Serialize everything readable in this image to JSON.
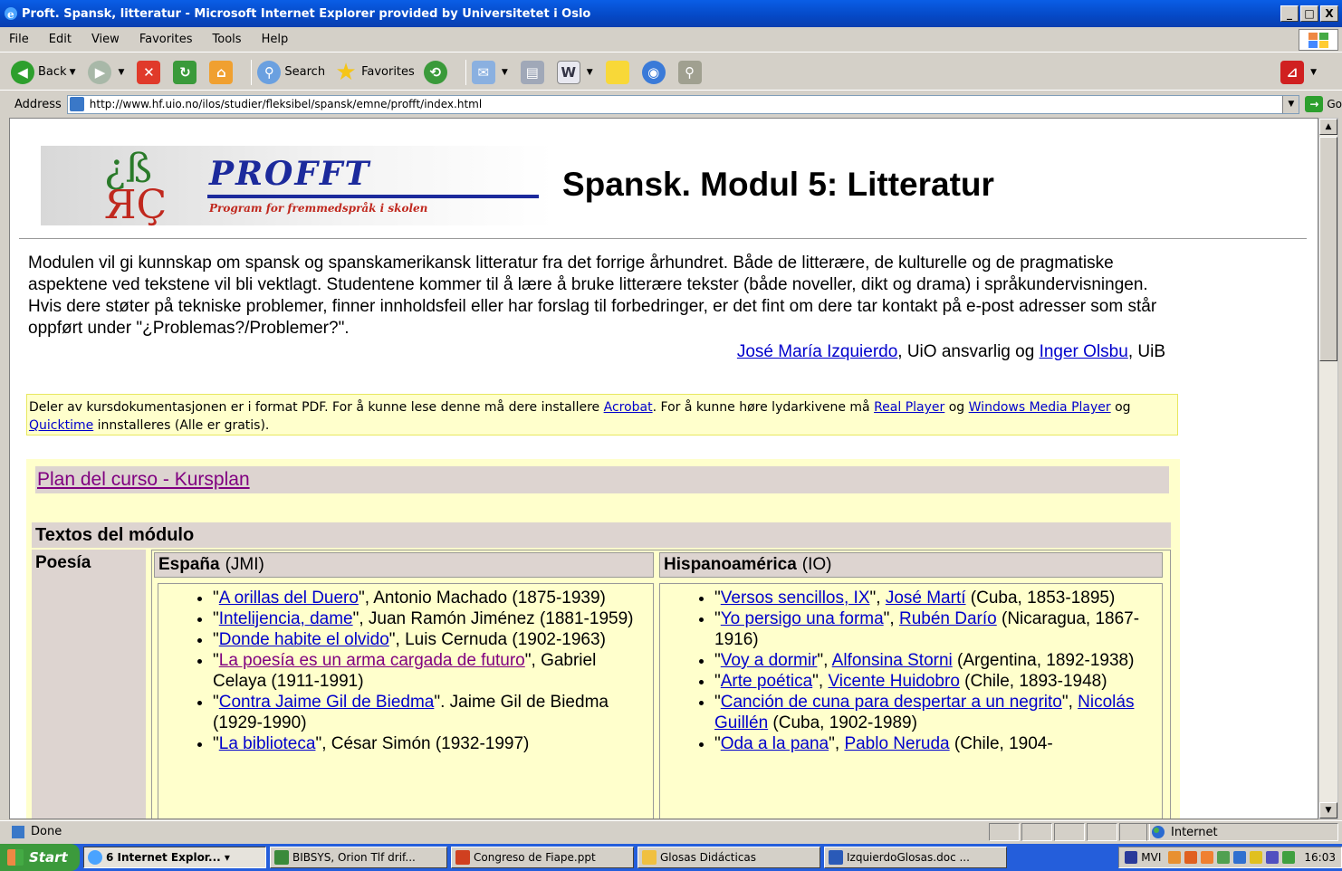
{
  "window": {
    "title": "Proft. Spansk, litteratur - Microsoft Internet Explorer provided by Universitetet i Oslo",
    "minimize": "_",
    "maximize": "□",
    "close": "X"
  },
  "menu": [
    "File",
    "Edit",
    "View",
    "Favorites",
    "Tools",
    "Help"
  ],
  "toolbar": {
    "back": "Back",
    "search": "Search",
    "favorites": "Favorites"
  },
  "address": {
    "label": "Address",
    "url": "http://www.hf.uio.no/ilos/studier/fleksibel/spansk/emne/profft/index.html",
    "go": "Go"
  },
  "page": {
    "logo": {
      "name": "PROFFT",
      "subtitle": "Program for fremmedspråk i skolen"
    },
    "title": "Spansk. Modul 5: Litteratur",
    "intro": "Modulen vil gi kunnskap om spansk og spanskamerikansk litteratur fra det forrige århundret. Både de litterære, de kulturelle og de pragmatiske aspektene ved tekstene vil bli vektlagt. Studentene kommer til å lære å bruke litterære tekster (både noveller, dikt og drama) i språkundervisningen. Hvis dere støter på tekniske problemer, finner innholdsfeil eller har forslag til forbedringer, er det fint om dere tar kontakt på e-post adresser som står oppført under \"¿Problemas?/Problemer?\".",
    "authors": {
      "person1": "José María Izquierdo",
      "mid": ", UiO ansvarlig og ",
      "person2": "Inger Olsbu",
      "end": ", UiB"
    },
    "notice": {
      "t1": "Deler av kursdokumentasjonen er i format PDF. For å kunne lese denne må dere installere ",
      "acrobat": "Acrobat",
      "t2": ". For å kunne høre lydarkivene må ",
      "real": "Real Player",
      "t3": " og ",
      "wmp": "Windows Media Player",
      "t4": " og ",
      "qt": "Quicktime",
      "t5": " innstalleres (Alle er gratis)."
    },
    "plan_link": "Plan del curso - Kursplan",
    "textos_heading": "Textos del módulo",
    "poesia": "Poesía",
    "espana": {
      "head_bold": "España",
      "head_rest": "(JMI)",
      "items": [
        {
          "q1": "\"",
          "link": "A orillas del Duero",
          "rest": "\", Antonio Machado (1875-1939)"
        },
        {
          "q1": "\"",
          "link": "Intelijencia, dame",
          "rest": "\", Juan Ramón Jiménez (1881-1959)"
        },
        {
          "q1": "\"",
          "link": "Donde habite el olvido",
          "rest": "\", Luis Cernuda (1902-1963)"
        },
        {
          "q1": "\"",
          "link": "La poesía es un arma cargada de futuro",
          "rest": "\", Gabriel Celaya (1911-1991)"
        },
        {
          "q1": "\"",
          "link": "Contra Jaime Gil de Biedma",
          "rest": "\". Jaime Gil de Biedma (1929-1990)"
        },
        {
          "q1": "\"",
          "link": "La biblioteca",
          "rest": "\", César Simón (1932-1997)"
        }
      ]
    },
    "hispano": {
      "head_bold": "Hispanoamérica",
      "head_rest": "(IO)",
      "items": [
        {
          "q1": "\"",
          "link": "Versos sencillos, IX",
          "mid": "\", ",
          "author": "José Martí",
          "rest": " (Cuba, 1853-1895)"
        },
        {
          "q1": "\"",
          "link": "Yo persigo una forma",
          "mid": "\", ",
          "author": "Rubén Darío",
          "rest": " (Nicaragua, 1867-1916)"
        },
        {
          "q1": "\"",
          "link": "Voy a dormir",
          "mid": "\", ",
          "author": "Alfonsina Storni",
          "rest": " (Argentina, 1892-1938)"
        },
        {
          "q1": "\"",
          "link": "Arte poética",
          "mid": "\", ",
          "author": "Vicente Huidobro",
          "rest": " (Chile, 1893-1948)"
        },
        {
          "q1": "\"",
          "link": "Canción de cuna para despertar a un negrito",
          "mid": "\", ",
          "author": "Nicolás Guillén",
          "rest": " (Cuba, 1902-1989)"
        },
        {
          "q1": "\"",
          "link": "Oda a la pana",
          "mid": "\", ",
          "author": "Pablo Neruda",
          "rest": " (Chile, 1904-"
        }
      ]
    }
  },
  "status": {
    "text": "Done",
    "zone": "Internet"
  },
  "taskbar": {
    "start": "Start",
    "tasks": [
      "6 Internet Explor... ▾",
      "BIBSYS, Orion Tlf drif...",
      "Congreso de Fiape.ppt",
      "Glosas Didácticas",
      "IzquierdoGlosas.doc ..."
    ],
    "tray_label": "MVI",
    "clock": "16:03"
  }
}
